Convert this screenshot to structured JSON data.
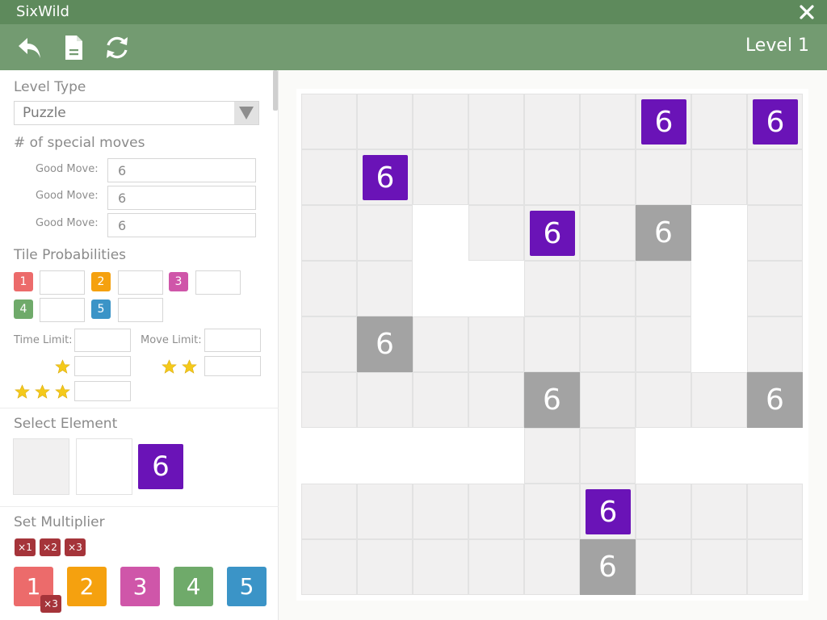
{
  "app": {
    "title": "SixWild"
  },
  "toolbar": {
    "level_label": "Level 1",
    "undo_icon": "undo-icon",
    "file_icon": "file-icon",
    "refresh_icon": "refresh-icon"
  },
  "level_type": {
    "title": "Level Type",
    "value": "Puzzle"
  },
  "special_moves": {
    "title": "# of special moves",
    "items": [
      {
        "label": "Good Move:",
        "value": "6"
      },
      {
        "label": "Good Move:",
        "value": "6"
      },
      {
        "label": "Good Move:",
        "value": "6"
      }
    ]
  },
  "tile_probabilities": {
    "title": "Tile Probabilities",
    "tiles": [
      {
        "label": "1",
        "color": "#ec6b6b",
        "value": ""
      },
      {
        "label": "2",
        "color": "#f5a10f",
        "value": ""
      },
      {
        "label": "3",
        "color": "#cf56a9",
        "value": ""
      },
      {
        "label": "4",
        "color": "#6faa6a",
        "value": ""
      },
      {
        "label": "5",
        "color": "#3b94c7",
        "value": ""
      }
    ]
  },
  "limits": {
    "time_label": "Time Limit:",
    "move_label": "Move Limit:",
    "star_color": "#f4c91b"
  },
  "select_element": {
    "title": "Select Element",
    "six_label": "6"
  },
  "set_multiplier": {
    "title": "Set Multiplier",
    "multipliers": [
      "×1",
      "×2",
      "×3"
    ],
    "numbers": [
      {
        "label": "1",
        "color": "#ec6b6b"
      },
      {
        "label": "2",
        "color": "#f5a10f"
      },
      {
        "label": "3",
        "color": "#cf56a9"
      },
      {
        "label": "4",
        "color": "#6faa6a"
      },
      {
        "label": "5",
        "color": "#3b94c7"
      }
    ],
    "applied_badge": "×3"
  },
  "board": {
    "six_color": "#6a13b7",
    "grey_color": "#a3a3a3",
    "rows": [
      [
        "n",
        "n",
        "n",
        "n",
        "n",
        "n",
        "p",
        "n",
        "p"
      ],
      [
        "n",
        "p",
        "n",
        "n",
        "n",
        "n",
        "n",
        "n",
        "n"
      ],
      [
        "n",
        "n",
        "v",
        "n",
        "p",
        "n",
        "g",
        "v",
        "n"
      ],
      [
        "n",
        "n",
        "v",
        "v",
        "n",
        "n",
        "n",
        "v",
        "n"
      ],
      [
        "n",
        "g",
        "n",
        "n",
        "n",
        "n",
        "n",
        "v",
        "n"
      ],
      [
        "n",
        "n",
        "n",
        "n",
        "g",
        "n",
        "n",
        "n",
        "g"
      ],
      [
        "v",
        "v",
        "v",
        "v",
        "n",
        "n",
        "v",
        "v",
        "v"
      ],
      [
        "n",
        "n",
        "n",
        "n",
        "n",
        "p",
        "n",
        "n",
        "n"
      ],
      [
        "n",
        "n",
        "n",
        "n",
        "n",
        "g",
        "n",
        "n",
        "n"
      ]
    ],
    "six_label": "6"
  }
}
